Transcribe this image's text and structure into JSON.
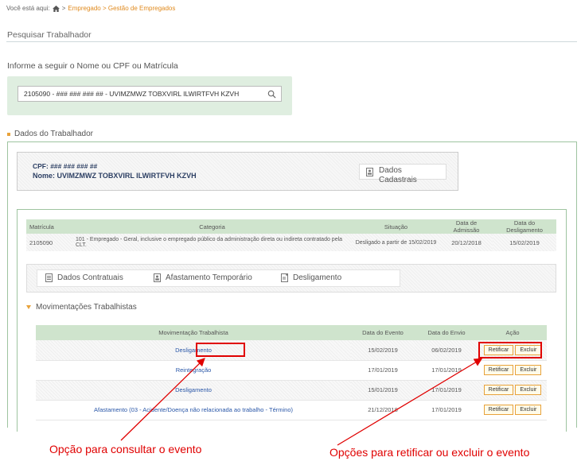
{
  "breadcrumb": {
    "prefix": "Você está aqui:",
    "sep": ">",
    "path": "Empregado > Gestão de Empregados"
  },
  "search": {
    "section_title": "Pesquisar Trabalhador",
    "instruction": "Informe a seguir o Nome ou CPF ou Matrícula",
    "value": "2105090 - ### ### ### ## - UVIMZMWZ TOBXVIRL ILWIRTFVH KZVH"
  },
  "dados": {
    "title": "Dados do Trabalhador",
    "cpf_label": "CPF: ### ### ### ##",
    "nome_label": "Nome: UVIMZMWZ TOBXVIRL ILWIRTFVH KZVH",
    "cadastrais_line1": "Dados",
    "cadastrais_line2": "Cadastrais"
  },
  "main_table": {
    "headers": [
      "Matrícula",
      "Categoria",
      "Situação",
      "Data de Admissão",
      "Data do Desligamento"
    ],
    "row": [
      "2105090",
      "101 - Empregado - Geral, inclusive o empregado público da administração direta ou indireta contratado pela CLT.",
      "Desligado a partir de 15/02/2019",
      "20/12/2018",
      "15/02/2019"
    ]
  },
  "tabs": [
    "Dados Contratuais",
    "Afastamento Temporário",
    "Desligamento"
  ],
  "movimentacoes": {
    "title": "Movimentações Trabalhistas",
    "headers": [
      "Movimentação Trabalhista",
      "Data do Evento",
      "Data do Envio",
      "Ação"
    ],
    "rows": [
      {
        "name": "Desligamento",
        "evento": "15/02/2019",
        "envio": "06/02/2019"
      },
      {
        "name": "Reintegração",
        "evento": "17/01/2019",
        "envio": "17/01/2019"
      },
      {
        "name": "Desligamento",
        "evento": "15/01/2019",
        "envio": "17/01/2019"
      },
      {
        "name": "Afastamento (03 - Acidente/Doença não relacionada ao trabalho - Término)",
        "evento": "21/12/2018",
        "envio": "17/01/2019"
      }
    ],
    "btn_retificar": "Retificar",
    "btn_excluir": "Excluir"
  },
  "annotations": {
    "left": "Opção para consultar o evento",
    "right": "Opções para retificar ou excluir o evento"
  },
  "colors": {
    "accent": "#e08a1e",
    "header_green": "#cfe4cd",
    "annotation": "#e00000",
    "link": "#2a57a8"
  }
}
